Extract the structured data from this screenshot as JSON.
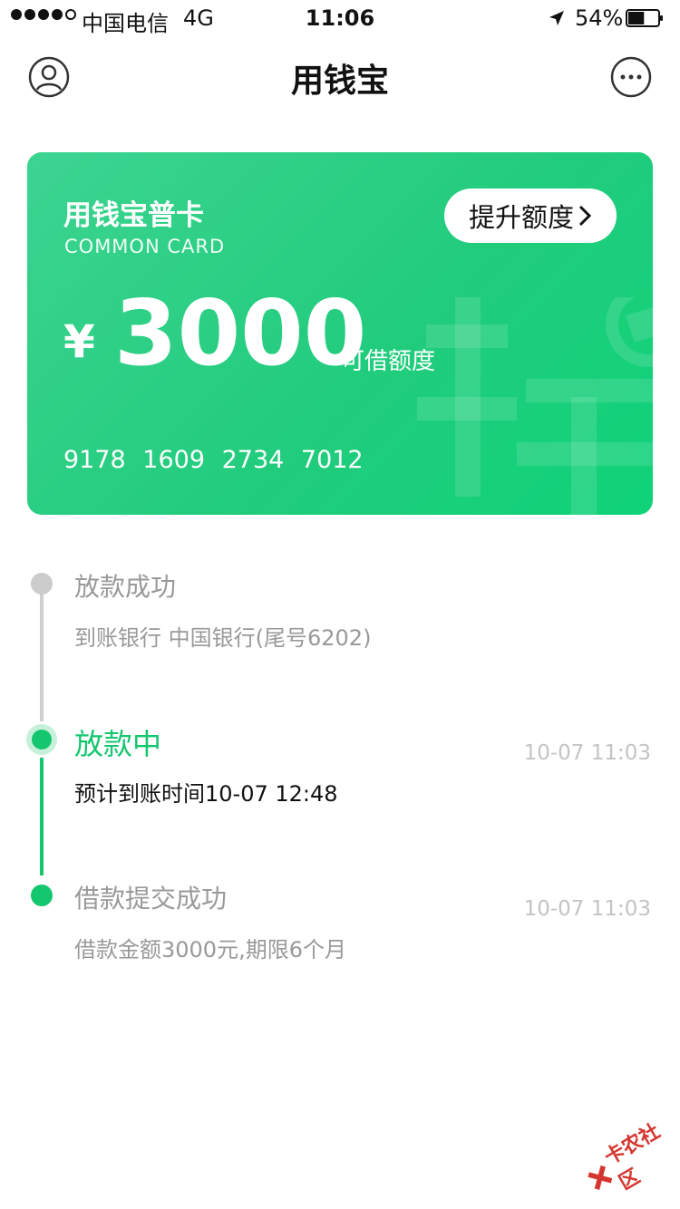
{
  "status_bar": {
    "carrier": "中国电信",
    "network": "4G",
    "time": "11:06",
    "battery": "54%",
    "battery_level": 0.54
  },
  "nav": {
    "title": "用钱宝",
    "left_icon": "user-icon",
    "right_icon": "more-icon"
  },
  "card": {
    "name": "用钱宝普卡",
    "subtitle": "COMMON CARD",
    "raise_button": "提升额度",
    "currency": "¥",
    "amount": "3000",
    "amount_label": "可借额度",
    "number": "9178 1609 2734 7012",
    "colors": {
      "gradient_start": "#3cd491",
      "gradient_end": "#0fd278"
    }
  },
  "timeline": {
    "accent": "#14c76f",
    "items": [
      {
        "title": "放款成功",
        "desc": "到账银行 中国银行(尾号6202)",
        "time": "",
        "state": "pending"
      },
      {
        "title": "放款中",
        "desc": "预计到账时间10-07 12:48",
        "time": "10-07 11:03",
        "state": "active"
      },
      {
        "title": "借款提交成功",
        "desc": "借款金额3000元,期限6个月",
        "time": "10-07 11:03",
        "state": "done"
      }
    ]
  },
  "watermark": {
    "text": "卡农社区"
  }
}
